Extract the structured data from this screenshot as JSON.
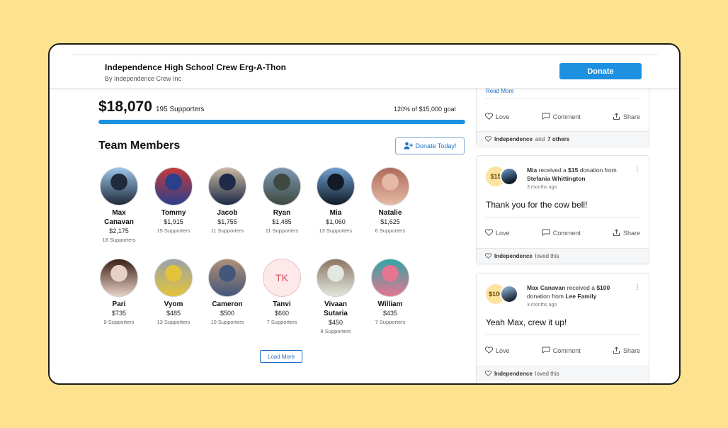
{
  "header": {
    "title": "Independence High School Crew Erg-A-Thon",
    "subtitle": "By Independence Crew Inc",
    "donate_label": "Donate"
  },
  "fundraiser": {
    "raised": "$18,070",
    "supporters": "195 Supporters",
    "goal_text": "120% of $15,000 goal",
    "progress_fraction": 1.0
  },
  "team": {
    "title": "Team Members",
    "donate_today_label": "Donate Today!",
    "load_more_label": "Load More",
    "members": [
      {
        "name": "Max",
        "name2": "Canavan",
        "amount": "$2,175",
        "supporters": "18 Supporters",
        "colors": [
          "#9bc4e8",
          "#1f2a3a"
        ]
      },
      {
        "name": "Tommy",
        "name2": "",
        "amount": "$1,915",
        "supporters": "15 Supporters",
        "colors": [
          "#c23b3b",
          "#2b3f8c"
        ]
      },
      {
        "name": "Jacob",
        "name2": "",
        "amount": "$1,755",
        "supporters": "11 Supporters",
        "colors": [
          "#c9b7a0",
          "#1d2a48"
        ]
      },
      {
        "name": "Ryan",
        "name2": "",
        "amount": "$1,485",
        "supporters": "11 Supporters",
        "colors": [
          "#7c98b3",
          "#3e4a40"
        ]
      },
      {
        "name": "Mia",
        "name2": "",
        "amount": "$1,060",
        "supporters": "13 Supporters",
        "colors": [
          "#6e9fcf",
          "#111a26"
        ]
      },
      {
        "name": "Natalie",
        "name2": "",
        "amount": "$1,625",
        "supporters": "6 Supporters",
        "colors": [
          "#b06a5a",
          "#e6b9a6"
        ]
      },
      {
        "name": "Pari",
        "name2": "",
        "amount": "$735",
        "supporters": "9 Supporters",
        "colors": [
          "#3b1f14",
          "#e7d0c5"
        ]
      },
      {
        "name": "Vyom",
        "name2": "",
        "amount": "$485",
        "supporters": "13 Supporters",
        "colors": [
          "#9aa3a9",
          "#e3c33a"
        ]
      },
      {
        "name": "Cameron",
        "name2": "",
        "amount": "$500",
        "supporters": "10 Supporters",
        "colors": [
          "#b08f76",
          "#44577a"
        ]
      },
      {
        "name": "Tanvi",
        "name2": "",
        "amount": "$660",
        "supporters": "7 Supporters",
        "initials": "TK"
      },
      {
        "name": "Vivaan",
        "name2": "Sutaria",
        "amount": "$450",
        "supporters": "8 Supporters",
        "colors": [
          "#8c7561",
          "#e2e7e0"
        ]
      },
      {
        "name": "William",
        "name2": "",
        "amount": "$435",
        "supporters": "7 Supporters",
        "colors": [
          "#2fa6a6",
          "#e6758f"
        ]
      }
    ]
  },
  "feed": {
    "read_more": "Read More",
    "love": "Love",
    "comment": "Comment",
    "share": "Share",
    "card0": {
      "likes_name": "Independence",
      "likes_rest": "and",
      "likes_others": "7 others"
    },
    "card1": {
      "badge": "$15",
      "donor": "Mia",
      "received": "received a",
      "amount": "$15",
      "donation_from": "donation from",
      "from": "Stefania Whittington",
      "time": "3 months ago",
      "message": "Thank you for the cow bell!",
      "likes_name": "Independence",
      "likes_rest": "loved this"
    },
    "card2": {
      "badge": "$100",
      "donor": "Max Canavan",
      "received": "received a",
      "amount": "$100",
      "donation_from": "donation from",
      "from": "Lee Family",
      "time": "3 months ago",
      "message": "Yeah Max, crew it up!",
      "likes_name": "Independence",
      "likes_rest": "loved this"
    }
  }
}
